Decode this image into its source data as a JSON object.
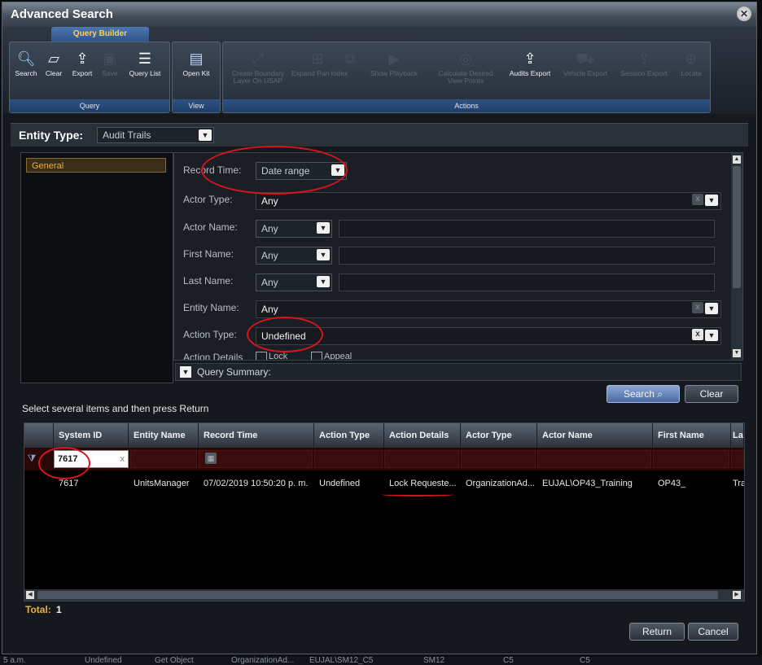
{
  "window": {
    "title": "Advanced Search",
    "close_glyph": "✕"
  },
  "ribbon": {
    "tab": "Query Builder",
    "groups": {
      "query": "Query",
      "view": "View",
      "actions": "Actions"
    },
    "buttons": [
      {
        "label": "Search",
        "icon": "magnifier-icon",
        "enabled": true
      },
      {
        "label": "Clear",
        "icon": "eraser-icon",
        "enabled": true
      },
      {
        "label": "Export",
        "icon": "export-icon",
        "enabled": true
      },
      {
        "label": "Save",
        "icon": "save-icon",
        "enabled": false
      },
      {
        "label": "Query List",
        "icon": "list-icon",
        "enabled": true
      },
      {
        "label": "Open Kit",
        "icon": "open-kit-icon",
        "enabled": true
      },
      {
        "label": "Create Boundary\nLayer On USAP",
        "icon": "boundary-icon",
        "enabled": false
      },
      {
        "label": "Expand Pan Index",
        "icon": "expand-icon",
        "enabled": false
      },
      {
        "label": "Show Playback",
        "icon": "playback-icon",
        "enabled": false
      },
      {
        "label": "Calculate Desired\nView Points",
        "icon": "view-points-icon",
        "enabled": false
      },
      {
        "label": "Audits Export",
        "icon": "audits-export-icon",
        "enabled": true
      },
      {
        "label": "Vehicle Export",
        "icon": "vehicle-icon",
        "enabled": false
      },
      {
        "label": "Session Export",
        "icon": "session-icon",
        "enabled": false
      },
      {
        "label": "Locate",
        "icon": "locate-icon",
        "enabled": false
      }
    ]
  },
  "entity": {
    "label": "Entity Type:",
    "value": "Audit Trails",
    "arrow": "▼"
  },
  "categories": [
    "General"
  ],
  "form": {
    "record_time": {
      "label": "Record Time:",
      "value": "Date range"
    },
    "actor_type": {
      "label": "Actor Type:",
      "value": "Any"
    },
    "actor_name": {
      "label": "Actor Name:",
      "value": "Any"
    },
    "first_name": {
      "label": "First Name:",
      "value": "Any"
    },
    "last_name": {
      "label": "Last Name:",
      "value": "Any"
    },
    "entity_name": {
      "label": "Entity Name:",
      "value": "Any"
    },
    "action_type": {
      "label": "Action Type:",
      "value": "Undefined"
    },
    "action_details": {
      "label": "Action Details",
      "opt1": "Lock",
      "opt2": "Appeal"
    },
    "clear_glyph": "x",
    "arrow": "▼"
  },
  "summary": {
    "label": "Query Summary:",
    "toggle": "▼"
  },
  "buttons": {
    "search": "Search ⌕",
    "clear": "Clear",
    "return": "Return",
    "cancel": "Cancel"
  },
  "instruction": "Select several items and then press Return",
  "grid": {
    "columns": [
      "System ID",
      "Entity Name",
      "Record Time",
      "Action Type",
      "Action Details",
      "Actor Type",
      "Actor Name",
      "First Name",
      "La"
    ],
    "filter": {
      "system_id": "7617",
      "clear_glyph": "x"
    },
    "rows": [
      [
        "7617",
        "UnitsManager",
        "07/02/2019 10:50:20 p. m.",
        "Undefined",
        "Lock Requeste...",
        "OrganizationAd...",
        "EUJAL\\OP43_Training",
        "OP43_",
        "Tra"
      ]
    ]
  },
  "total": {
    "label": "Total:",
    "value": "1"
  },
  "background_row": [
    "5 a.m.",
    "Undefined",
    "Get Object",
    "OrganizationAd...",
    "EUJAL\\SM12_C5",
    "SM12",
    "C5",
    "C5"
  ]
}
